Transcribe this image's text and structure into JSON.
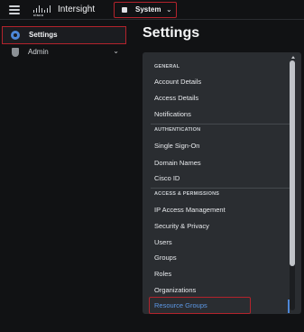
{
  "topbar": {
    "brand_name": "cisco",
    "app_name": "Intersight",
    "scope_label": "System",
    "menu_icon": "hamburger-menu-icon",
    "scope_icon": "system-icon",
    "chevron_icon": "chevron-down-icon"
  },
  "sidebar": {
    "items": [
      {
        "label": "Settings",
        "icon": "gear-icon",
        "active": true
      },
      {
        "label": "Admin",
        "icon": "shield-icon",
        "active": false,
        "expandable": true
      }
    ]
  },
  "page": {
    "title": "Settings"
  },
  "panel": {
    "sections": [
      {
        "header": "GENERAL",
        "links": [
          "Account Details",
          "Access Details",
          "Notifications"
        ]
      },
      {
        "header": "AUTHENTICATION",
        "links": [
          "Single Sign-On",
          "Domain Names",
          "Cisco ID"
        ]
      },
      {
        "header": "ACCESS & PERMISSIONS",
        "links": [
          "IP Access Management",
          "Security & Privacy",
          "Users",
          "Groups",
          "Roles",
          "Organizations",
          "Resource Groups"
        ]
      }
    ],
    "active_link": "Resource Groups"
  },
  "colors": {
    "background": "#111214",
    "panel": "#2a2d31",
    "accent": "#4d87d8",
    "active_link": "#5c98e6",
    "highlight_border": "#b3232c"
  }
}
